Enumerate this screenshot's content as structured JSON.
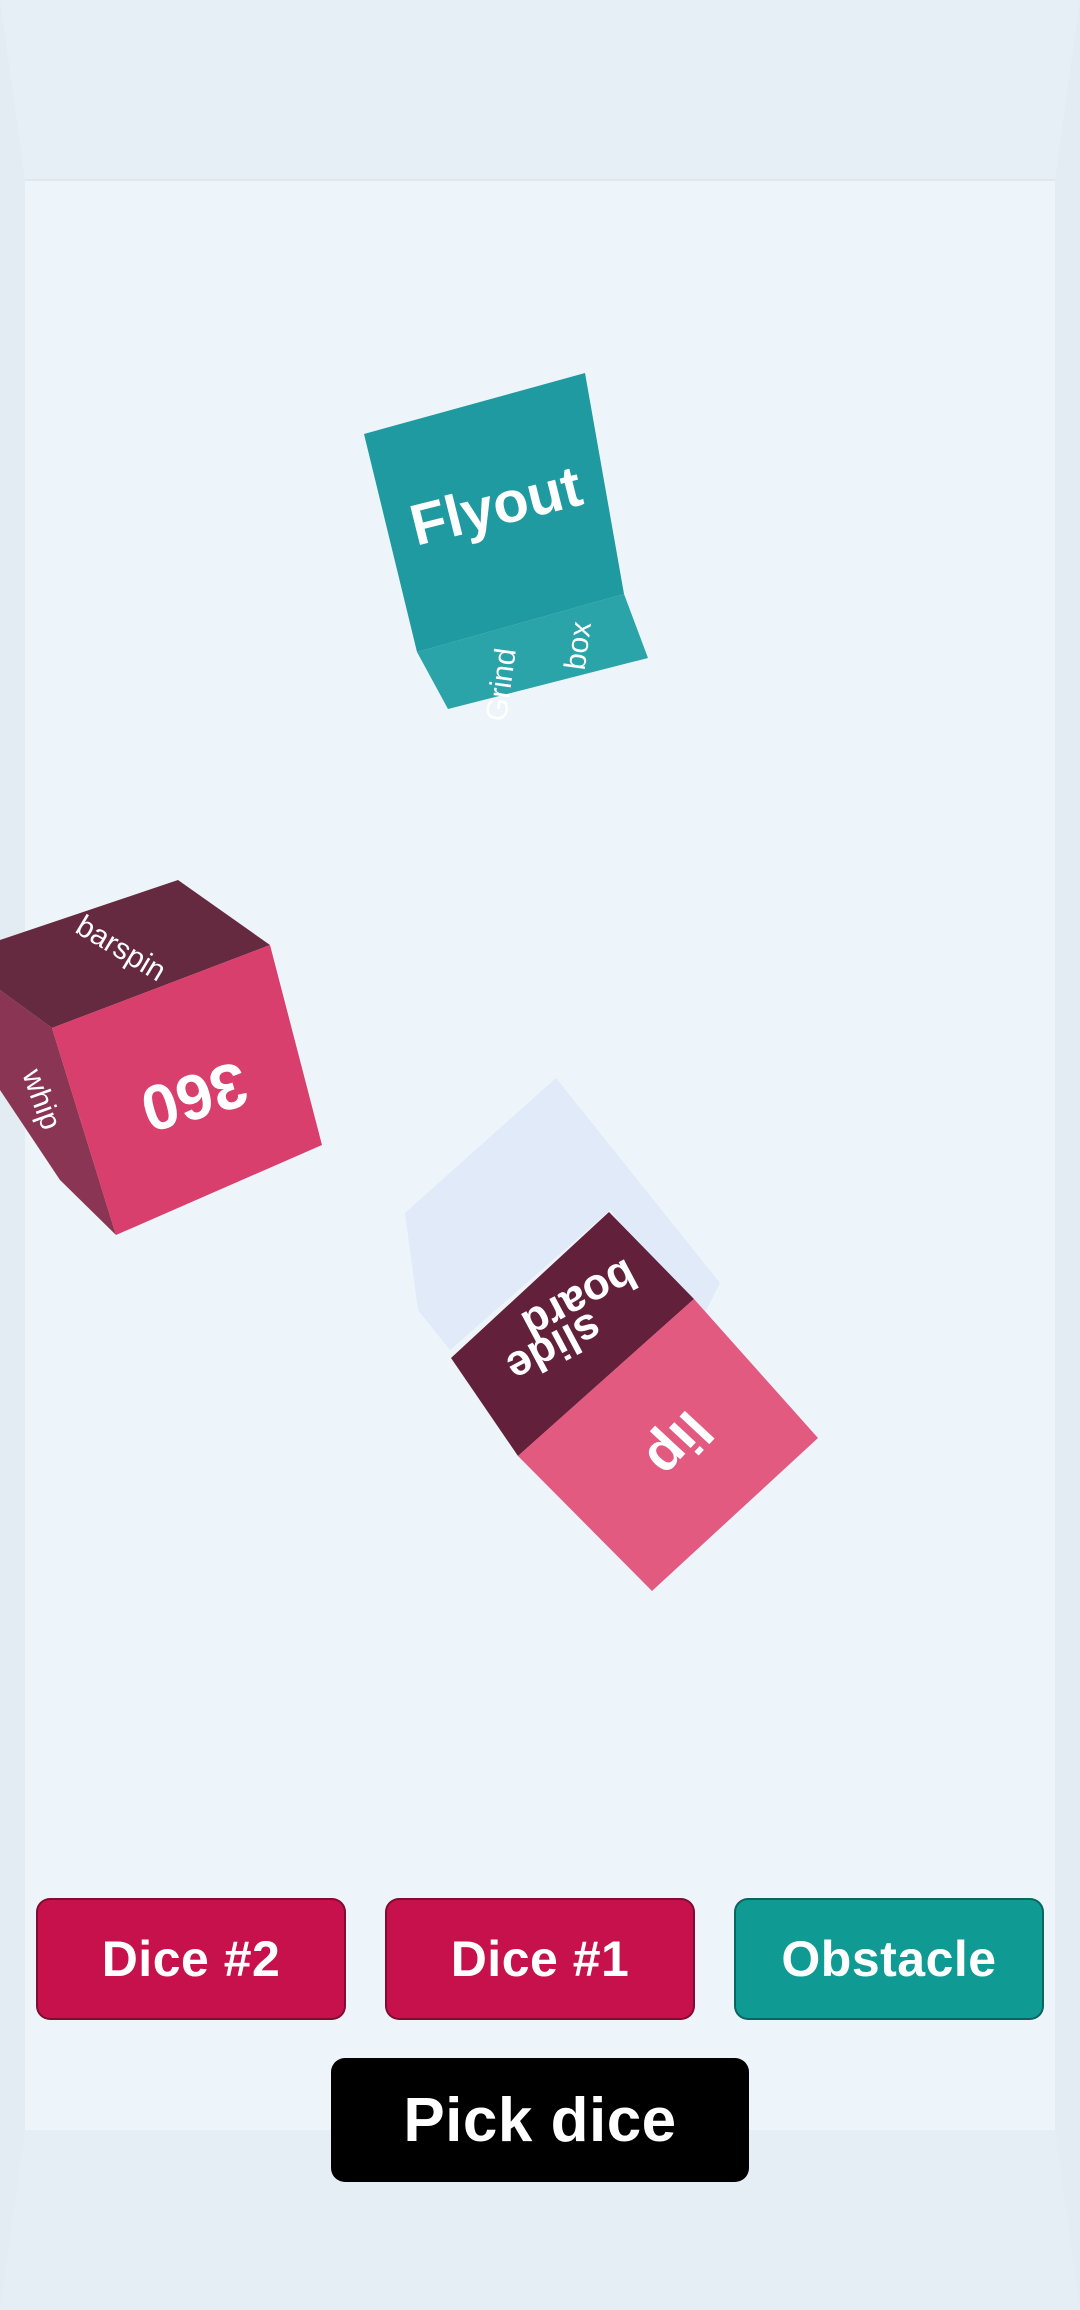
{
  "dice": [
    {
      "id": "obstacle",
      "colors": {
        "front": "#1f9aa0",
        "bottom": "#2aa4a8"
      },
      "faces": {
        "front": "Flyout",
        "bottom_left": "Grind",
        "bottom_right": "box"
      }
    },
    {
      "id": "dice-2",
      "colors": {
        "front": "#d83f6d",
        "top": "#652a40",
        "left": "#8a3553"
      },
      "faces": {
        "front": "360",
        "top": "barspin",
        "left": "whip"
      }
    },
    {
      "id": "dice-1",
      "colors": {
        "front": "#e25a80",
        "top": "#63203b",
        "ghost": "#dfe9f8"
      },
      "faces": {
        "front": "lip",
        "top": "board slide"
      }
    }
  ],
  "controls": {
    "dice2_label": "Dice #2",
    "dice1_label": "Dice #1",
    "obstacle_label": "Obstacle",
    "pick_label": "Pick dice"
  },
  "colors": {
    "dice_button": "#c6114c",
    "obstacle_button": "#0f9b93",
    "pick_button": "#000000",
    "background": "#e9f1f7"
  }
}
